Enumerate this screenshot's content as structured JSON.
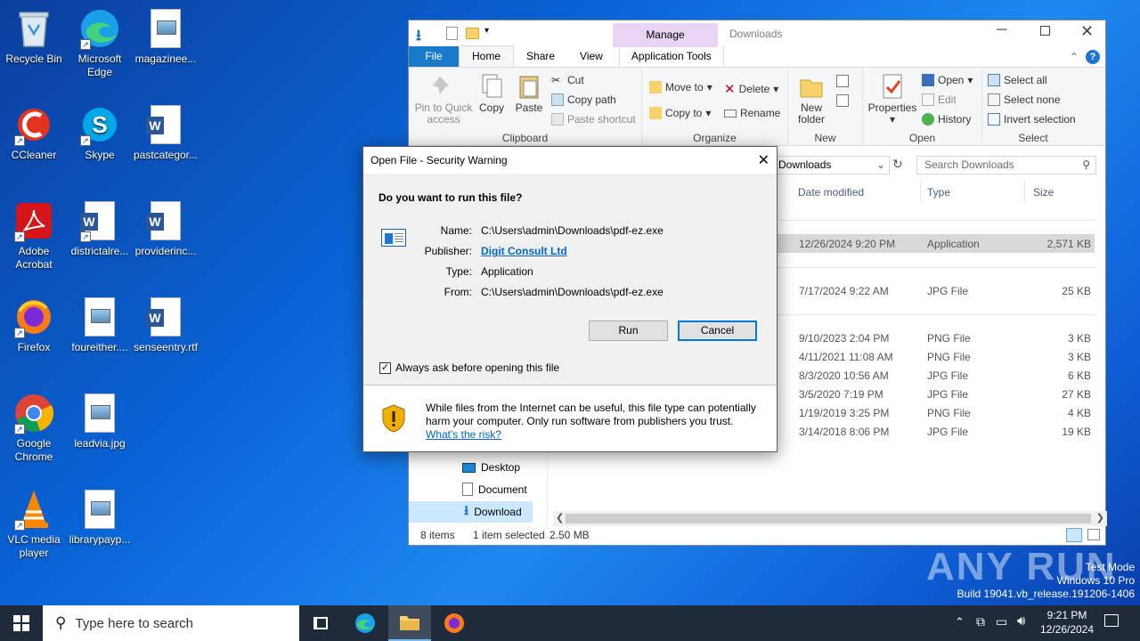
{
  "desktop": {
    "icons": [
      {
        "label": "Recycle Bin"
      },
      {
        "label": "Microsoft Edge"
      },
      {
        "label": "magazinee..."
      },
      {
        "label": "CCleaner"
      },
      {
        "label": "Skype"
      },
      {
        "label": "pastcategor..."
      },
      {
        "label": "Adobe Acrobat"
      },
      {
        "label": "districtalre..."
      },
      {
        "label": "providerinc..."
      },
      {
        "label": "Firefox"
      },
      {
        "label": "foureither...."
      },
      {
        "label": "senseentry.rtf"
      },
      {
        "label": "Google Chrome"
      },
      {
        "label": "leadvia.jpg"
      },
      {
        "label": "VLC media player"
      },
      {
        "label": "librarypayp..."
      }
    ]
  },
  "explorer": {
    "title": "Downloads",
    "context_tab": "Manage",
    "tabs": {
      "file": "File",
      "home": "Home",
      "share": "Share",
      "view": "View",
      "app_tools": "Application Tools"
    },
    "clipboard": {
      "pin": "Pin to Quick access",
      "copy": "Copy",
      "paste": "Paste",
      "cut": "Cut",
      "copy_path": "Copy path",
      "paste_shortcut": "Paste shortcut",
      "label": "Clipboard"
    },
    "organize": {
      "move_to": "Move to",
      "copy_to": "Copy to",
      "delete": "Delete",
      "rename": "Rename",
      "label": "Organize"
    },
    "new": {
      "new_folder": "New folder",
      "label": "New"
    },
    "open": {
      "properties": "Properties",
      "open": "Open",
      "edit": "Edit",
      "history": "History",
      "label": "Open"
    },
    "select": {
      "select_all": "Select all",
      "select_none": "Select none",
      "invert": "Invert selection",
      "label": "Select"
    },
    "address": "Downloads",
    "search_placeholder": "Search Downloads",
    "columns": {
      "date": "Date modified",
      "type": "Type",
      "size": "Size"
    },
    "files": [
      {
        "date": "12/26/2024 9:20 PM",
        "type": "Application",
        "size": "2,571 KB"
      },
      {
        "date": "7/17/2024 9:22 AM",
        "type": "JPG File",
        "size": "25 KB"
      },
      {
        "date": "9/10/2023 2:04 PM",
        "type": "PNG File",
        "size": "3 KB"
      },
      {
        "date": "4/11/2021 11:08 AM",
        "type": "PNG File",
        "size": "3 KB"
      },
      {
        "date": "8/3/2020 10:56 AM",
        "type": "JPG File",
        "size": "6 KB"
      },
      {
        "date": "3/5/2020 7:19 PM",
        "type": "JPG File",
        "size": "27 KB"
      },
      {
        "date": "1/19/2019 3:25 PM",
        "type": "PNG File",
        "size": "4 KB"
      },
      {
        "date": "3/14/2018 8:06 PM",
        "type": "JPG File",
        "size": "19 KB"
      }
    ],
    "nav": {
      "desktop": "Desktop",
      "documents": "Document",
      "downloads": "Download"
    },
    "status": {
      "items": "8 items",
      "selected": "1 item selected",
      "size": "2.50 MB"
    }
  },
  "dialog": {
    "title": "Open File - Security Warning",
    "question": "Do you want to run this file?",
    "name_label": "Name:",
    "name_value": "C:\\Users\\admin\\Downloads\\pdf-ez.exe",
    "publisher_label": "Publisher:",
    "publisher_value": "Digit Consult Ltd",
    "type_label": "Type:",
    "type_value": "Application",
    "from_label": "From:",
    "from_value": "C:\\Users\\admin\\Downloads\\pdf-ez.exe",
    "run": "Run",
    "cancel": "Cancel",
    "checkbox": "Always ask before opening this file",
    "warning": "While files from the Internet can be useful, this file type can potentially harm your computer. Only run software from publishers you trust.",
    "risk_link": "What's the risk?"
  },
  "watermark": {
    "brand": "ANY RUN",
    "mode": "Test Mode",
    "os": "Windows 10 Pro",
    "build": "Build 19041.vb_release.191206-1406"
  },
  "taskbar": {
    "search_placeholder": "Type here to search",
    "time": "9:21 PM",
    "date": "12/26/2024"
  },
  "colors": {
    "accent": "#0078d7",
    "manage_tab": "#e8d4f4",
    "selection": "#d9d9d9",
    "link": "#0066cc"
  }
}
